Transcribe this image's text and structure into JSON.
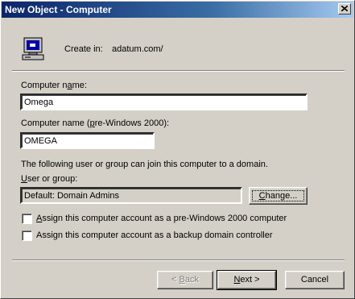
{
  "window": {
    "title": "New Object - Computer"
  },
  "header": {
    "create_in_label": "Create in:",
    "create_in_value": "adatum.com/"
  },
  "fields": {
    "computer_name_label": [
      "Computer n",
      "a",
      "me:"
    ],
    "computer_name_value": "Omega",
    "pre2000_label": [
      "Computer name (",
      "p",
      "re-Windows 2000):"
    ],
    "pre2000_value": "OMEGA",
    "join_text": "The following user or group can join this computer to a domain.",
    "user_group_label": [
      "",
      "U",
      "ser or group:"
    ],
    "user_group_value": "Default: Domain Admins",
    "change_button": [
      "",
      "C",
      "hange..."
    ]
  },
  "options": {
    "pre2000_checkbox": [
      "",
      "A",
      "ssign this computer account as a pre-Windows 2000 computer"
    ],
    "pre2000_checked": false,
    "bdc_checkbox": [
      "Assi",
      "g",
      "n this computer account as a backup domain controller"
    ],
    "bdc_checked": false
  },
  "footer": {
    "back_button": [
      "< ",
      "B",
      "ack"
    ],
    "next_button": [
      "",
      "N",
      "ext >"
    ],
    "cancel_button": "Cancel"
  }
}
